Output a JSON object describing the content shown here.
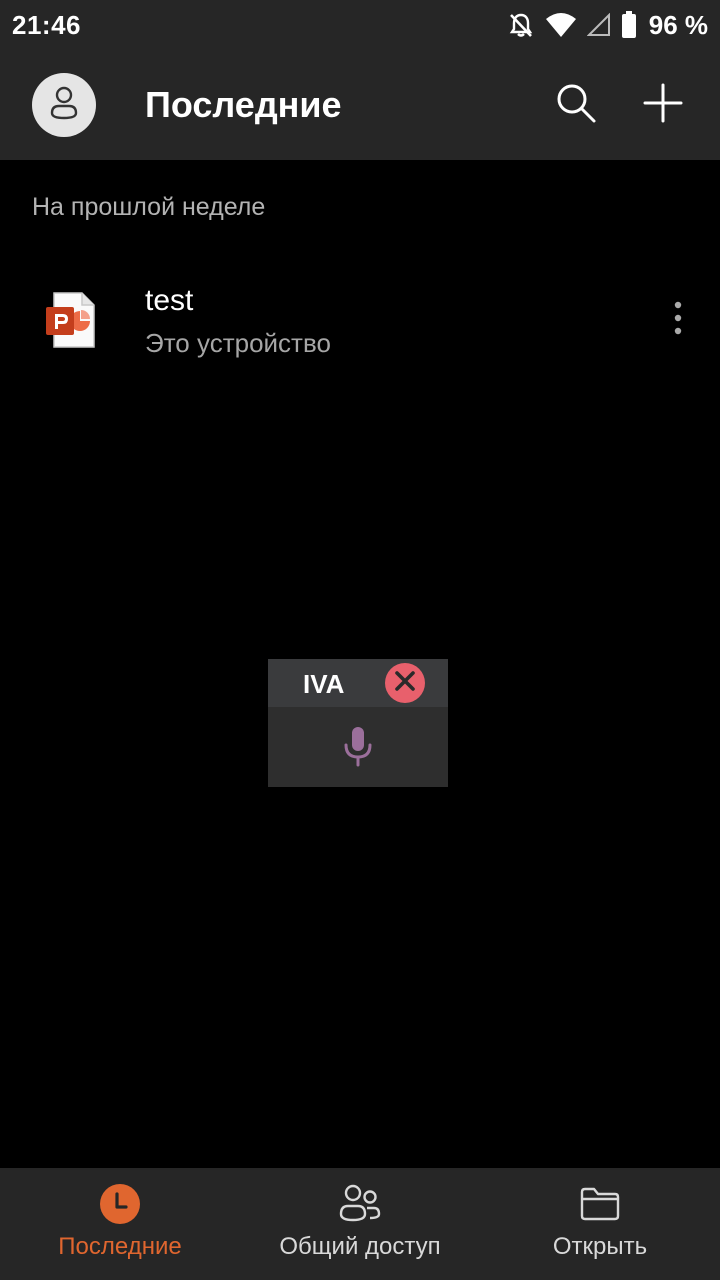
{
  "status_bar": {
    "time": "21:46",
    "battery_percent": "96 %",
    "icons": [
      "notifications-off-icon",
      "wifi-icon",
      "signal-icon",
      "battery-icon"
    ]
  },
  "header": {
    "title": "Последние",
    "avatar_icon": "person-icon",
    "actions": [
      "search-icon",
      "plus-icon"
    ]
  },
  "section": {
    "label": "На прошлой неделе"
  },
  "files": [
    {
      "name": "test",
      "location": "Это устройство",
      "icon": "powerpoint-file-icon"
    }
  ],
  "iva": {
    "title": "IVA",
    "close_icon": "close-icon",
    "mic_icon": "microphone-icon"
  },
  "bottom_nav": {
    "items": [
      {
        "label": "Последние",
        "icon": "clock-icon",
        "active": true
      },
      {
        "label": "Общий доступ",
        "icon": "people-icon",
        "active": false
      },
      {
        "label": "Открыть",
        "icon": "folder-icon",
        "active": false
      }
    ]
  },
  "colors": {
    "accent": "#e0662f",
    "header_bg": "#262626",
    "background": "#000000",
    "iva_close": "#e8606c",
    "iva_mic": "#9b6f9b"
  }
}
